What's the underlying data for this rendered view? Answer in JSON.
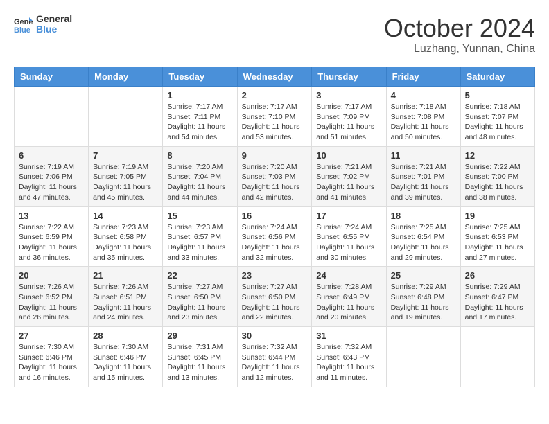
{
  "header": {
    "logo_line1": "General",
    "logo_line2": "Blue",
    "month": "October 2024",
    "location": "Luzhang, Yunnan, China"
  },
  "weekdays": [
    "Sunday",
    "Monday",
    "Tuesday",
    "Wednesday",
    "Thursday",
    "Friday",
    "Saturday"
  ],
  "weeks": [
    [
      {
        "day": "",
        "detail": ""
      },
      {
        "day": "",
        "detail": ""
      },
      {
        "day": "1",
        "detail": "Sunrise: 7:17 AM\nSunset: 7:11 PM\nDaylight: 11 hours and 54 minutes."
      },
      {
        "day": "2",
        "detail": "Sunrise: 7:17 AM\nSunset: 7:10 PM\nDaylight: 11 hours and 53 minutes."
      },
      {
        "day": "3",
        "detail": "Sunrise: 7:17 AM\nSunset: 7:09 PM\nDaylight: 11 hours and 51 minutes."
      },
      {
        "day": "4",
        "detail": "Sunrise: 7:18 AM\nSunset: 7:08 PM\nDaylight: 11 hours and 50 minutes."
      },
      {
        "day": "5",
        "detail": "Sunrise: 7:18 AM\nSunset: 7:07 PM\nDaylight: 11 hours and 48 minutes."
      }
    ],
    [
      {
        "day": "6",
        "detail": "Sunrise: 7:19 AM\nSunset: 7:06 PM\nDaylight: 11 hours and 47 minutes."
      },
      {
        "day": "7",
        "detail": "Sunrise: 7:19 AM\nSunset: 7:05 PM\nDaylight: 11 hours and 45 minutes."
      },
      {
        "day": "8",
        "detail": "Sunrise: 7:20 AM\nSunset: 7:04 PM\nDaylight: 11 hours and 44 minutes."
      },
      {
        "day": "9",
        "detail": "Sunrise: 7:20 AM\nSunset: 7:03 PM\nDaylight: 11 hours and 42 minutes."
      },
      {
        "day": "10",
        "detail": "Sunrise: 7:21 AM\nSunset: 7:02 PM\nDaylight: 11 hours and 41 minutes."
      },
      {
        "day": "11",
        "detail": "Sunrise: 7:21 AM\nSunset: 7:01 PM\nDaylight: 11 hours and 39 minutes."
      },
      {
        "day": "12",
        "detail": "Sunrise: 7:22 AM\nSunset: 7:00 PM\nDaylight: 11 hours and 38 minutes."
      }
    ],
    [
      {
        "day": "13",
        "detail": "Sunrise: 7:22 AM\nSunset: 6:59 PM\nDaylight: 11 hours and 36 minutes."
      },
      {
        "day": "14",
        "detail": "Sunrise: 7:23 AM\nSunset: 6:58 PM\nDaylight: 11 hours and 35 minutes."
      },
      {
        "day": "15",
        "detail": "Sunrise: 7:23 AM\nSunset: 6:57 PM\nDaylight: 11 hours and 33 minutes."
      },
      {
        "day": "16",
        "detail": "Sunrise: 7:24 AM\nSunset: 6:56 PM\nDaylight: 11 hours and 32 minutes."
      },
      {
        "day": "17",
        "detail": "Sunrise: 7:24 AM\nSunset: 6:55 PM\nDaylight: 11 hours and 30 minutes."
      },
      {
        "day": "18",
        "detail": "Sunrise: 7:25 AM\nSunset: 6:54 PM\nDaylight: 11 hours and 29 minutes."
      },
      {
        "day": "19",
        "detail": "Sunrise: 7:25 AM\nSunset: 6:53 PM\nDaylight: 11 hours and 27 minutes."
      }
    ],
    [
      {
        "day": "20",
        "detail": "Sunrise: 7:26 AM\nSunset: 6:52 PM\nDaylight: 11 hours and 26 minutes."
      },
      {
        "day": "21",
        "detail": "Sunrise: 7:26 AM\nSunset: 6:51 PM\nDaylight: 11 hours and 24 minutes."
      },
      {
        "day": "22",
        "detail": "Sunrise: 7:27 AM\nSunset: 6:50 PM\nDaylight: 11 hours and 23 minutes."
      },
      {
        "day": "23",
        "detail": "Sunrise: 7:27 AM\nSunset: 6:50 PM\nDaylight: 11 hours and 22 minutes."
      },
      {
        "day": "24",
        "detail": "Sunrise: 7:28 AM\nSunset: 6:49 PM\nDaylight: 11 hours and 20 minutes."
      },
      {
        "day": "25",
        "detail": "Sunrise: 7:29 AM\nSunset: 6:48 PM\nDaylight: 11 hours and 19 minutes."
      },
      {
        "day": "26",
        "detail": "Sunrise: 7:29 AM\nSunset: 6:47 PM\nDaylight: 11 hours and 17 minutes."
      }
    ],
    [
      {
        "day": "27",
        "detail": "Sunrise: 7:30 AM\nSunset: 6:46 PM\nDaylight: 11 hours and 16 minutes."
      },
      {
        "day": "28",
        "detail": "Sunrise: 7:30 AM\nSunset: 6:46 PM\nDaylight: 11 hours and 15 minutes."
      },
      {
        "day": "29",
        "detail": "Sunrise: 7:31 AM\nSunset: 6:45 PM\nDaylight: 11 hours and 13 minutes."
      },
      {
        "day": "30",
        "detail": "Sunrise: 7:32 AM\nSunset: 6:44 PM\nDaylight: 11 hours and 12 minutes."
      },
      {
        "day": "31",
        "detail": "Sunrise: 7:32 AM\nSunset: 6:43 PM\nDaylight: 11 hours and 11 minutes."
      },
      {
        "day": "",
        "detail": ""
      },
      {
        "day": "",
        "detail": ""
      }
    ]
  ]
}
